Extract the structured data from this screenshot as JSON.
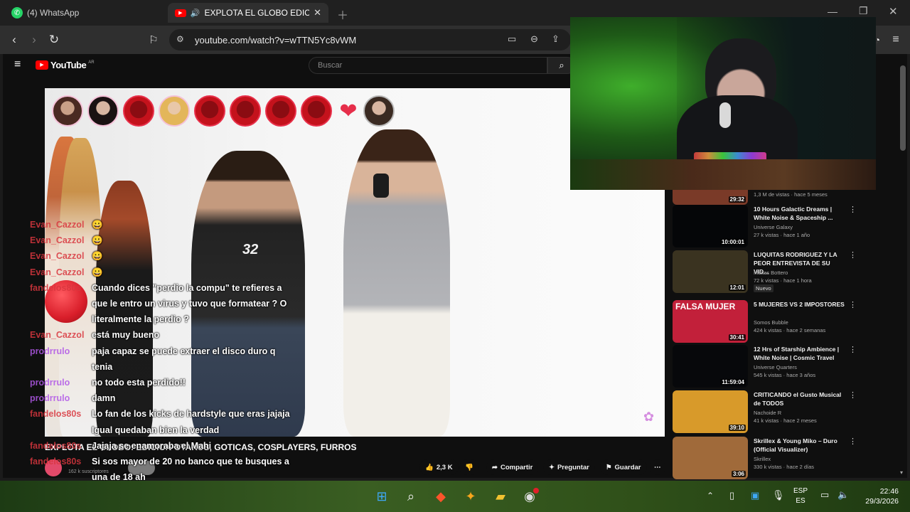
{
  "tabs": [
    {
      "label": "(4) WhatsApp",
      "icon": "whatsapp-icon"
    },
    {
      "label": "EXPLOTA EL GLOBO EDICION",
      "icon": "youtube-icon"
    }
  ],
  "address": {
    "url": "youtube.com/watch?v=wTTN5Yc8vWM"
  },
  "youtube": {
    "logo": "YouTube",
    "region": "AR",
    "search_placeholder": "Buscar"
  },
  "video": {
    "title_overlay": "EXPLOTA EL GLOBO EDICION GOTICAS, COSPLAYERS, FURROS",
    "title_strip": "EXPLOTA EL GLOBO: EDICION OTAKUS, GOTICAS, COSPLAYERS, FURROS",
    "channel_subs": "162 k suscriptores"
  },
  "actions": {
    "likes": "2,3 K",
    "share": "Compartir",
    "ask": "Preguntar",
    "save": "Guardar"
  },
  "chat": [
    {
      "user": "Evan_Cazzol",
      "msg": "😀",
      "color": "#d9363e"
    },
    {
      "user": "Evan_Cazzol",
      "msg": "😀",
      "color": "#d9363e"
    },
    {
      "user": "Evan_Cazzol",
      "msg": "😀",
      "color": "#d9363e"
    },
    {
      "user": "Evan_Cazzol",
      "msg": "😀",
      "color": "#d9363e"
    },
    {
      "user": "fandelos80s",
      "msg": "Cuando dices \"perdio la compu\" te refieres a",
      "color": "#d9363e"
    },
    {
      "user": "",
      "msg": "que le entro un virus y tuvo que formatear ? O",
      "color": "#fff"
    },
    {
      "user": "",
      "msg": "literalmente la perdio ?",
      "color": "#fff"
    },
    {
      "user": "Evan_Cazzol",
      "msg": "está muy bueno",
      "color": "#d9363e"
    },
    {
      "user": "prodrrulo",
      "msg": "paja capaz se puede extraer el disco duro q",
      "color": "#b157e8"
    },
    {
      "user": "",
      "msg": "tenia",
      "color": "#fff"
    },
    {
      "user": "prodrrulo",
      "msg": "no todo esta perdido!!",
      "color": "#b157e8"
    },
    {
      "user": "prodrrulo",
      "msg": "damn",
      "color": "#b157e8"
    },
    {
      "user": "fandelos80s",
      "msg": "Lo fan de los kicks de hardstyle que eras jajaja",
      "color": "#d9363e"
    },
    {
      "user": "",
      "msg": "Igual quedaban bien la verdad",
      "color": "#fff"
    },
    {
      "user": "fandelos80s",
      "msg": "Jajaja se enamoraba el Mahi",
      "color": "#d9363e"
    },
    {
      "user": "fandelos80s",
      "msg": "Si sos mayor de 20 no banco que te busques a",
      "color": "#d9363e"
    },
    {
      "user": "",
      "msg": "una de 18 ah",
      "color": "#fff"
    }
  ],
  "recommended": [
    {
      "title": "",
      "meta1": "1,3 M de vistas · hace 5 meses",
      "meta2": "",
      "duration": "29:32",
      "thumb": "#7a3a28"
    },
    {
      "title": "10 Hours Galactic Dreams | White Noise & Spaceship ...",
      "meta1": "Universe Galaxy",
      "meta2": "27 k vistas · hace 1 año",
      "duration": "10:00:01",
      "thumb": "#050608"
    },
    {
      "title": "LUQUITAS RODRIGUEZ Y LA PEOR ENTREVISTA DE SU VID...",
      "meta1": "Matias Bottero",
      "meta2": "72 k vistas · hace 1 hora",
      "badge": "Nuevo",
      "duration": "12:01",
      "thumb": "#3a3320"
    },
    {
      "title": "5 MUJERES VS 2 IMPOSTORES",
      "meta1": "Somos Bubble",
      "meta2": "424 k vistas · hace 2 semanas",
      "duration": "30:41",
      "thumb": "#c2203a",
      "thumb_text": "FALSA MUJER"
    },
    {
      "title": "12 Hrs of Starship Ambience | White Noise | Cosmic Travel",
      "meta1": "Universe Quarters",
      "meta2": "545 k vistas · hace 3 años",
      "duration": "11:59:04",
      "thumb": "#07080b"
    },
    {
      "title": "CRITICANDO el Gusto Musical de TODOS",
      "meta1": "Nachoide R",
      "meta2": "41 k vistas · hace 2 meses",
      "duration": "39:10",
      "thumb": "#d89a2a"
    },
    {
      "title": "Skrillex & Young Miko – Duro (Official Visualizer)",
      "meta1": "Skrillex",
      "meta2": "330 k vistas · hace 2 días",
      "duration": "3:06",
      "thumb": "#a06a3a"
    }
  ],
  "taskbar": {
    "lang": "ESP",
    "lang_sub": "ES",
    "time": "22:46",
    "date": "29/3/2026"
  },
  "colors": {
    "youtube_red": "#ff0000",
    "chat_red": "#d9363e",
    "chat_purple": "#b157e8",
    "balloon": "#d91e2a"
  }
}
